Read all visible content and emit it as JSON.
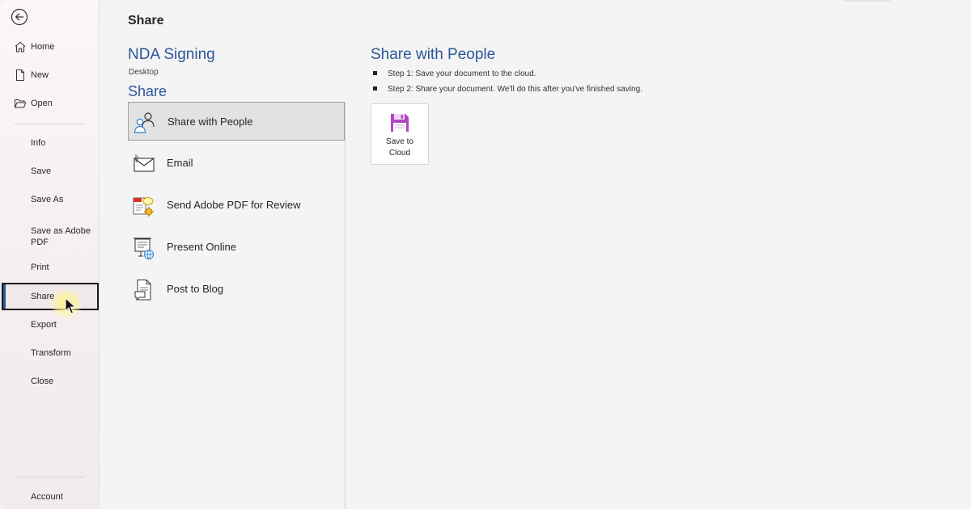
{
  "sidebar": {
    "back_icon": "back-arrow-icon",
    "items": [
      {
        "label": "Home",
        "icon": "home-icon"
      },
      {
        "label": "New",
        "icon": "new-document-icon"
      },
      {
        "label": "Open",
        "icon": "open-folder-icon"
      },
      {
        "label": "Info"
      },
      {
        "label": "Save"
      },
      {
        "label": "Save As"
      },
      {
        "label": "Save as Adobe PDF"
      },
      {
        "label": "Print"
      },
      {
        "label": "Share"
      },
      {
        "label": "Export"
      },
      {
        "label": "Transform"
      },
      {
        "label": "Close"
      },
      {
        "label": "Account"
      }
    ],
    "selected": "Share"
  },
  "main": {
    "page_title": "Share",
    "document": {
      "name": "NDA Signing",
      "location": "Desktop"
    },
    "section_heading": "Share",
    "share_options": [
      {
        "label": "Share with People",
        "icon": "share-people-icon"
      },
      {
        "label": "Email",
        "icon": "email-icon"
      },
      {
        "label": "Send Adobe PDF for Review",
        "icon": "adobe-pdf-review-icon"
      },
      {
        "label": "Present Online",
        "icon": "present-online-icon"
      },
      {
        "label": "Post to Blog",
        "icon": "post-blog-icon"
      }
    ],
    "selected_option": "Share with People"
  },
  "pane": {
    "title": "Share with People",
    "steps": [
      "Step 1: Save your document to the cloud.",
      "Step 2: Share your document. We'll do this after you've finished saving."
    ],
    "save_button": {
      "label": "Save to Cloud",
      "icon": "floppy-disk-icon"
    }
  },
  "colors": {
    "accent_blue": "#2b5797",
    "selection_bar": "#2b579a",
    "save_icon_purple": "#b146c2"
  }
}
